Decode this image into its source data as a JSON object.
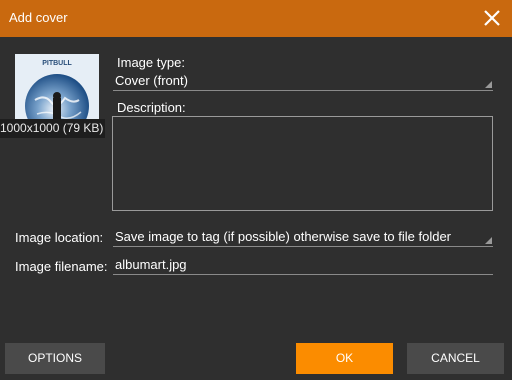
{
  "dialog": {
    "title": "Add cover",
    "close_icon": "close-icon"
  },
  "cover": {
    "album_text": "PITBULL",
    "size_text": "1000x1000 (79 KB)"
  },
  "fields": {
    "image_type_label": "Image type:",
    "image_type_value": "Cover (front)",
    "description_label": "Description:",
    "description_value": "",
    "location_label": "Image location:",
    "location_value": "Save image to tag (if possible) otherwise save to file folder",
    "filename_label": "Image filename:",
    "filename_value": "albumart.jpg"
  },
  "buttons": {
    "options": "OPTIONS",
    "ok": "OK",
    "cancel": "CANCEL"
  },
  "colors": {
    "titlebar": "#c9690f",
    "background": "#2f2f2f",
    "ok_button": "#fb8c00",
    "secondary_button": "#4a4a4a"
  }
}
